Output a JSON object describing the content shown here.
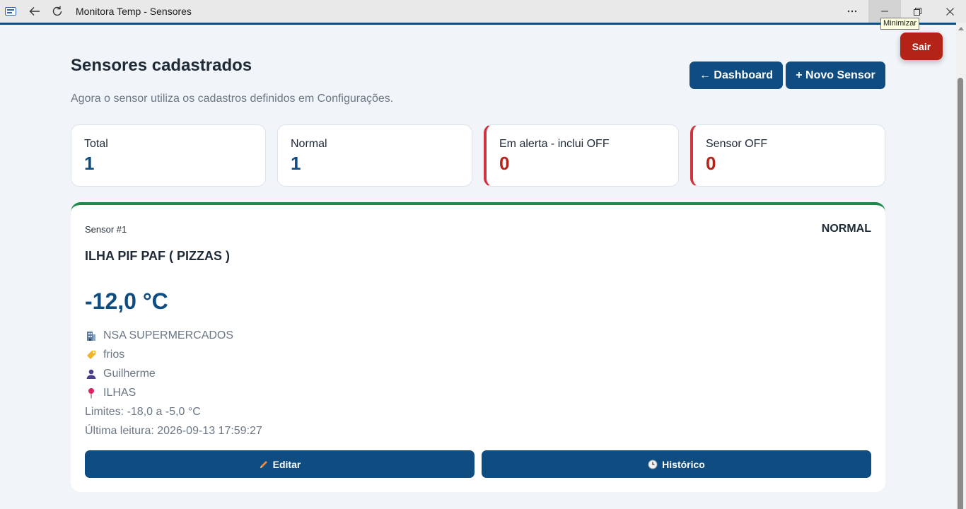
{
  "window": {
    "title": "Monitora Temp - Sensores",
    "tooltip": "Minimizar"
  },
  "header": {
    "title": "Sensores cadastrados",
    "subtitle": "Agora o sensor utiliza os cadastros definidos em Configurações.",
    "dashboard_label": "← Dashboard",
    "novo_sensor_label": "+ Novo Sensor",
    "sair_label": "Sair"
  },
  "stats": {
    "total": {
      "label": "Total",
      "value": "1"
    },
    "normal": {
      "label": "Normal",
      "value": "1"
    },
    "alerta": {
      "label": "Em alerta - inclui OFF",
      "value": "0"
    },
    "off": {
      "label": "Sensor OFF",
      "value": "0"
    }
  },
  "sensor": {
    "number": "Sensor #1",
    "status": "NORMAL",
    "name": "ILHA PIF PAF ( PIZZAS )",
    "temperature": "-12,0 °C",
    "company": "NSA SUPERMERCADOS",
    "category": "frios",
    "responsible": "Guilherme",
    "location": "ILHAS",
    "limits": "Limites: -18,0 a -5,0 °C",
    "last_reading": "Última leitura: 2026-09-13 17:59:27",
    "edit_label": "Editar",
    "history_label": "Histórico"
  },
  "colors": {
    "primary": "#0f4c81",
    "danger": "#b42318",
    "alert_border": "#d0343f",
    "normal_border": "#1e8a4a",
    "background": "#f1f4f8"
  },
  "icons": {
    "company": "building-icon",
    "category": "tag-icon",
    "responsible": "person-icon",
    "location": "pin-icon",
    "edit": "pencil-icon",
    "history": "clock-icon"
  }
}
